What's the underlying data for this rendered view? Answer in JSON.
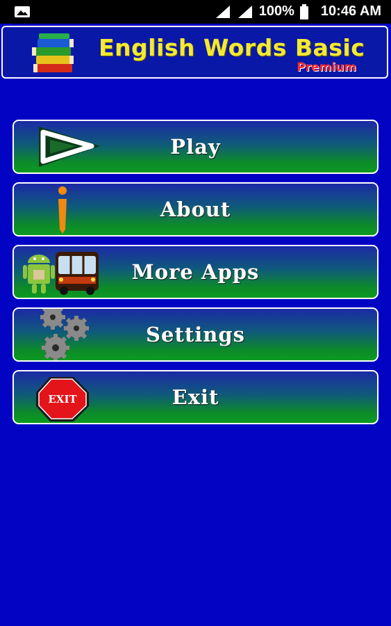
{
  "status_bar": {
    "battery": "100%",
    "time": "10:46 AM"
  },
  "header": {
    "title": "English Words Basic",
    "subtitle": "Premium"
  },
  "menu": {
    "play": "Play",
    "about": "About",
    "more_apps": "More Apps",
    "settings": "Settings",
    "exit": "Exit",
    "exit_sign_text": "EXIT"
  },
  "colors": {
    "background": "#0303c4",
    "title": "#f2ea33",
    "subtitle": "#ff2a2a",
    "button_top": "#1c2aa6",
    "button_bottom": "#0c9a20"
  },
  "icons": [
    "image-icon",
    "signal-icon",
    "battery-icon",
    "books-icon",
    "play-icon",
    "info-icon",
    "android-bus-icon",
    "gears-icon",
    "exit-sign-icon"
  ]
}
